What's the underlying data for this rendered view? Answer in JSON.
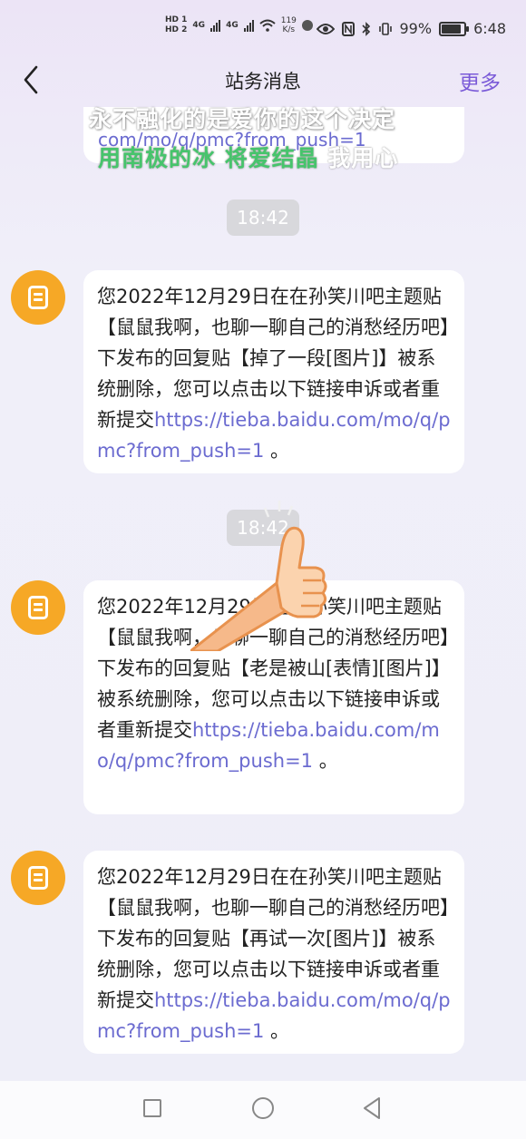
{
  "status_bar": {
    "hd1": "HD 1",
    "hd2": "HD 2",
    "net1": "4G",
    "net2": "4G",
    "speed_value": "119",
    "speed_unit": "K/s",
    "battery": "99%",
    "time": "6:48"
  },
  "header": {
    "title": "站务消息",
    "more": "更多"
  },
  "overlay": {
    "lyric_line1": "永不融化的是爱你的这个决定",
    "lyric_line2_green": "用南极的冰 将爱结晶",
    "lyric_line2_white": " 我用心"
  },
  "top_message": {
    "link_tail": "com/mo/q/pmc?from_push=1"
  },
  "messages": [
    {
      "time": "18:42",
      "text": "您2022年12月29日在在孙笑川吧主题贴【鼠鼠我啊，也聊一聊自己的消愁经历吧】下发布的回复贴【掉了一段[图片]】被系统删除，您可以点击以下链接申诉或者重新提交",
      "link": "https://tieba.baidu.com/mo/q/pmc?from_push=1",
      "tail": " 。"
    },
    {
      "time": "18:42",
      "text": "您2022年12月29日在在孙笑川吧主题贴【鼠鼠我啊，也聊一聊自己的消愁经历吧】下发布的回复贴【老是被山[表情][图片]】被系统删除，您可以点击以下链接申诉或者重新提交",
      "link": "https://tieba.baidu.com/mo/q/pmc?from_push=1",
      "tail": " 。"
    },
    {
      "text": "您2022年12月29日在在孙笑川吧主题贴【鼠鼠我啊，也聊一聊自己的消愁经历吧】下发布的回复贴【再试一次[图片]】被系统删除，您可以点击以下链接申诉或者重新提交",
      "link": "https://tieba.baidu.com/mo/q/pmc?from_push=1",
      "tail": " 。"
    }
  ],
  "icons": {
    "back": "chevron-left-icon",
    "avatar": "document-icon",
    "reaction": "thumbs-up-icon",
    "nav_recent": "square-icon",
    "nav_home": "circle-icon",
    "nav_back": "triangle-back-icon"
  },
  "colors": {
    "accent": "#7b5bd8",
    "link": "#6b6bd0",
    "avatar": "#f6a826",
    "lyric_green": "#47c46c"
  }
}
